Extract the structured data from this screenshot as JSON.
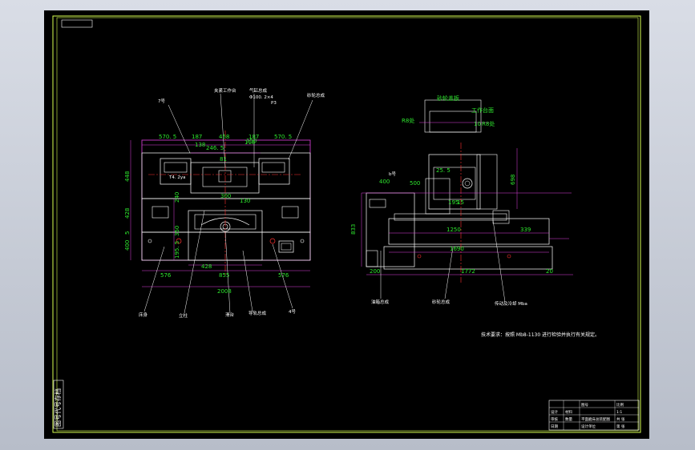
{
  "left_view": {
    "dims": {
      "top_left": "570. 5",
      "top_right": "570. 5",
      "d187a": "187",
      "d138": "138",
      "d458": "458",
      "d187b": "187",
      "d2465": "246. 5",
      "d150": "150",
      "d81": "81",
      "d300": "300",
      "d130": "130",
      "d118": "118",
      "h448": "448",
      "h428": "428",
      "h5": "5",
      "h400": "400",
      "h240": "240",
      "h1955": "195. 5",
      "h350": "350",
      "b428": "428",
      "b576l": "576",
      "b855": "855",
      "b576r": "576",
      "b2008": "2008",
      "bottom_tick": "T4. 2ya"
    },
    "labels": {
      "top1": "7号",
      "top2": "夹紧工作台",
      "top3": "气缸总成",
      "top3b": "Φ100. 2×4",
      "top3c": "P3",
      "top4": "砂轮总成",
      "bot1": "床身",
      "bot2": "立柱",
      "bot3": "滑台",
      "bot4": "导轨总成",
      "bot5": "4号"
    }
  },
  "right_view": {
    "dims": {
      "w400": "400",
      "w500": "500",
      "w1250": "1250",
      "w339": "339",
      "w1690": "1690",
      "w200": "200",
      "w1772": "1772",
      "w20": "20",
      "h833": "833",
      "h698": "698",
      "d25": "25. 5",
      "d195": "195",
      "d15": "15",
      "top_a": "砂轮盖板",
      "top_b": "工作台面",
      "top_l": "R8处",
      "top_r": "R8处",
      "top_10": "10"
    },
    "labels": {
      "p1": "b号",
      "bot1": "油箱总成",
      "bot2": "砂轮总成",
      "bot3": "传动及冷却 Mba"
    }
  },
  "note": "技术要求：按照 Mb8-1130 进行检验并执行有关规定。",
  "title_block": {
    "drawing_name": "平面磨床总装配图",
    "scale_label": "比例",
    "company": "设计单位",
    "sheet_label": "图号",
    "qty_label": "数量",
    "material_label": "材料",
    "designer": "设计",
    "checker": "审核",
    "date": "日期",
    "r1": "1:1",
    "r2": "共 张",
    "r3": "第 张"
  },
  "stamp": "图号代号存档"
}
